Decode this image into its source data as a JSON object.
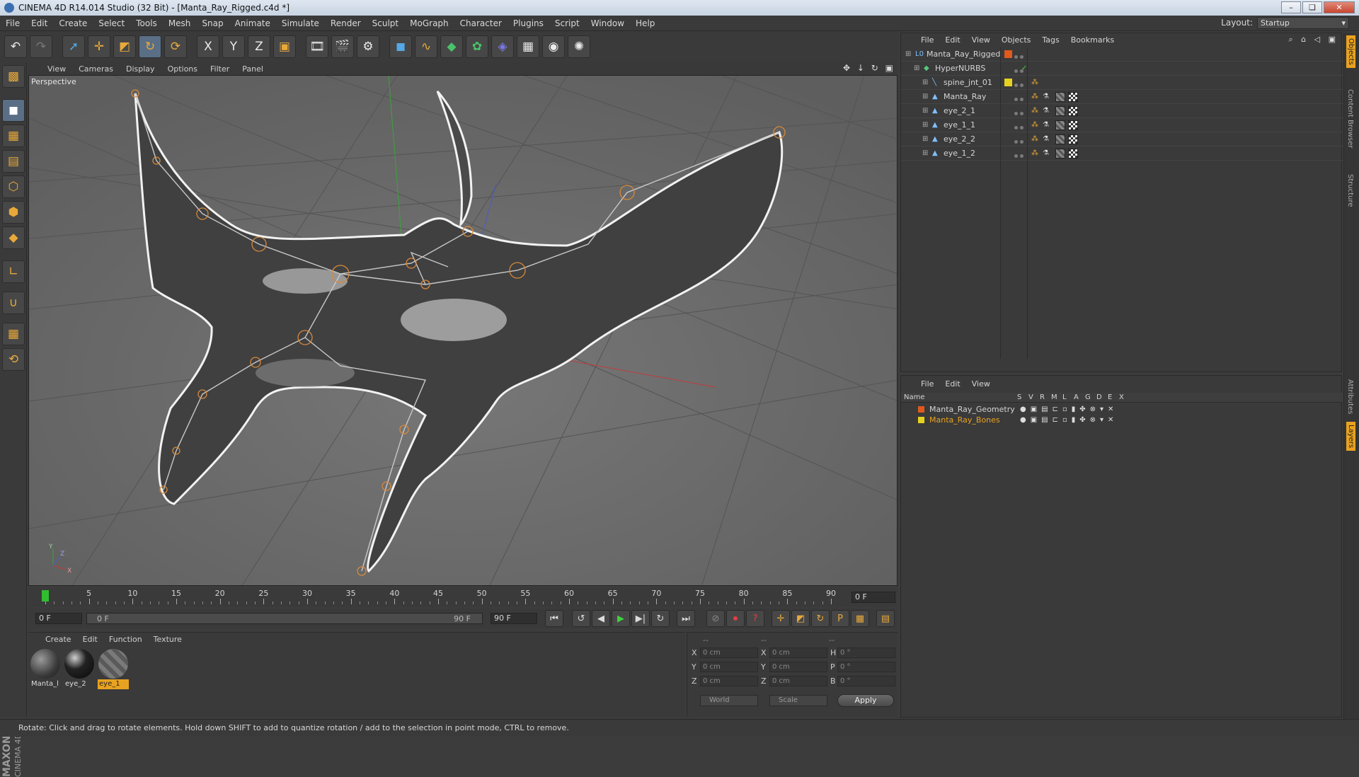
{
  "window": {
    "title": "CINEMA 4D R14.014 Studio (32 Bit) - [Manta_Ray_Rigged.c4d *]",
    "minimize": "–",
    "restore": "❏",
    "close": "✕"
  },
  "menubar": {
    "items": [
      "File",
      "Edit",
      "Create",
      "Select",
      "Tools",
      "Mesh",
      "Snap",
      "Animate",
      "Simulate",
      "Render",
      "Sculpt",
      "MoGraph",
      "Character",
      "Plugins",
      "Script",
      "Window",
      "Help"
    ],
    "layout_label": "Layout:",
    "layout_value": "Startup"
  },
  "toolbar": {
    "icons": [
      "undo-icon",
      "redo-icon",
      "live-selection-icon",
      "move-icon",
      "scale-icon",
      "rotate-icon",
      "recent-tool-icon",
      "x-axis-icon",
      "y-axis-icon",
      "z-axis-icon",
      "coordinate-system-icon",
      "render-view-icon",
      "render-picture-viewer-icon",
      "render-settings-icon",
      "cube-primitive-icon",
      "spline-icon",
      "nurbs-icon",
      "array-icon",
      "deformer-icon",
      "floor-environment-icon",
      "camera-icon",
      "light-icon"
    ],
    "axis_x": "X",
    "axis_y": "Y",
    "axis_z": "Z"
  },
  "left_tools": {
    "icons": [
      "make-editable-icon",
      "model-mode-icon",
      "texture-mode-icon",
      "workplane-icon",
      "points-mode-icon",
      "edges-mode-icon",
      "polygons-mode-icon",
      "axis-mode-icon",
      "magnet-icon",
      "snap-grid-icon",
      "lock-workplane-icon"
    ],
    "brand_maxon": "MAXON",
    "brand_product": "CINEMA 4D"
  },
  "viewport": {
    "menu": [
      "View",
      "Cameras",
      "Display",
      "Options",
      "Filter",
      "Panel"
    ],
    "label": "Perspective",
    "nav_icons": "✥ ↓ ↻ ▣",
    "axis_labels": [
      "Y",
      "Z",
      "X"
    ]
  },
  "timeline": {
    "ticks": [
      "0",
      "5",
      "10",
      "15",
      "20",
      "25",
      "30",
      "35",
      "40",
      "45",
      "50",
      "55",
      "60",
      "65",
      "70",
      "75",
      "80",
      "85",
      "90"
    ],
    "current_frame_right": "0 F",
    "start_frame": "0 F",
    "range_start": "0 F",
    "range_end": "90 F",
    "end_frame": "90 F",
    "current_frame_index": 0
  },
  "material_manager": {
    "menu": [
      "Create",
      "Edit",
      "Function",
      "Texture"
    ],
    "materials": [
      {
        "name": "Manta_l",
        "selected": false,
        "color": "#5a5a5a"
      },
      {
        "name": "eye_2",
        "selected": false,
        "color": "#202020"
      },
      {
        "name": "eye_1",
        "selected": true,
        "color": "#777777"
      }
    ]
  },
  "coordinates": {
    "header_dashes": [
      "--",
      "--",
      "--"
    ],
    "rows": [
      {
        "axis": "X",
        "pos": "0 cm",
        "size_axis": "X",
        "size": "0 cm",
        "rot_axis": "H",
        "rot": "0 °"
      },
      {
        "axis": "Y",
        "pos": "0 cm",
        "size_axis": "Y",
        "size": "0 cm",
        "rot_axis": "P",
        "rot": "0 °"
      },
      {
        "axis": "Z",
        "pos": "0 cm",
        "size_axis": "Z",
        "size": "0 cm",
        "rot_axis": "B",
        "rot": "0 °"
      }
    ],
    "space_select": "World",
    "mode_select": "Scale",
    "apply": "Apply"
  },
  "status": {
    "text": "Rotate: Click and drag to rotate elements. Hold down SHIFT to add to quantize rotation / add to the selection in point mode, CTRL to remove."
  },
  "object_manager": {
    "menu": [
      "File",
      "Edit",
      "View",
      "Objects",
      "Tags",
      "Bookmarks"
    ],
    "objects": [
      {
        "name": "Manta_Ray_Rigged",
        "depth": 0,
        "icon": "null-object-icon",
        "color": "#e05a1e"
      },
      {
        "name": "HyperNURBS",
        "depth": 1,
        "icon": "hypernurbs-icon",
        "color": ""
      },
      {
        "name": "spine_jnt_01",
        "depth": 2,
        "icon": "joint-icon",
        "color": "#e6d21e"
      },
      {
        "name": "Manta_Ray",
        "depth": 2,
        "icon": "polygon-object-icon",
        "color": ""
      },
      {
        "name": "eye_2_1",
        "depth": 2,
        "icon": "polygon-object-icon",
        "color": ""
      },
      {
        "name": "eye_1_1",
        "depth": 2,
        "icon": "polygon-object-icon",
        "color": ""
      },
      {
        "name": "eye_2_2",
        "depth": 2,
        "icon": "polygon-object-icon",
        "color": ""
      },
      {
        "name": "eye_1_2",
        "depth": 2,
        "icon": "polygon-object-icon",
        "color": ""
      }
    ]
  },
  "side_tabs": [
    "Objects",
    "Content Browser",
    "Structure",
    "Attributes",
    "Layers"
  ],
  "layer_manager": {
    "menu": [
      "File",
      "Edit",
      "View"
    ],
    "columns": [
      "Name",
      "S",
      "V",
      "R",
      "M",
      "L",
      "A",
      "G",
      "D",
      "E",
      "X"
    ],
    "layers": [
      {
        "name": "Manta_Ray_Geometry",
        "color": "#e05a1e",
        "text_color": "#d5d5d5"
      },
      {
        "name": "Manta_Ray_Bones",
        "color": "#e6d21e",
        "text_color": "#e9a21f"
      }
    ]
  }
}
